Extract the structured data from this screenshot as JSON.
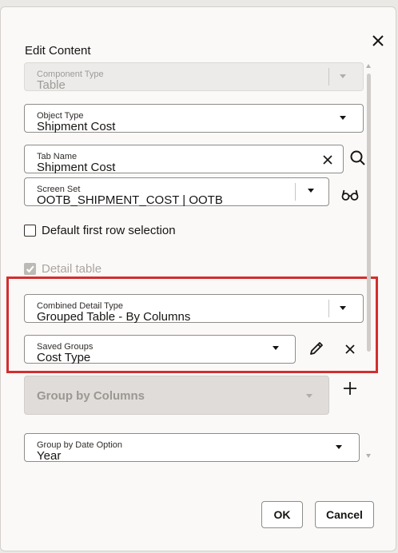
{
  "dialog": {
    "title": "Edit Content"
  },
  "fields": {
    "component_type": {
      "label": "Component Type",
      "value": "Table"
    },
    "object_type": {
      "label": "Object Type",
      "value": "Shipment Cost"
    },
    "tab_name": {
      "label": "Tab Name",
      "value": "Shipment Cost"
    },
    "screen_set": {
      "label": "Screen Set",
      "value": "OOTB_SHIPMENT_COST | OOTB"
    },
    "combined_detail_type": {
      "label": "Combined Detail Type",
      "value": "Grouped Table - By Columns"
    },
    "saved_groups": {
      "label": "Saved Groups",
      "value": "Cost Type"
    },
    "group_by_date_option": {
      "label": "Group by Date Option",
      "value": "Year"
    }
  },
  "checkboxes": {
    "default_first_row": {
      "label": "Default first row selection",
      "checked": false
    },
    "detail_table": {
      "label": "Detail table",
      "checked": true,
      "disabled": true
    }
  },
  "group_by_columns": {
    "label": "Group by Columns"
  },
  "footer": {
    "ok_label": "OK",
    "cancel_label": "Cancel"
  },
  "icons": {
    "close": "close-icon",
    "clear": "clear-icon",
    "search": "search-icon",
    "view": "glasses-icon",
    "edit": "pencil-icon",
    "remove": "remove-icon",
    "add": "plus-icon"
  },
  "colors": {
    "highlight": "#d22e2e"
  }
}
